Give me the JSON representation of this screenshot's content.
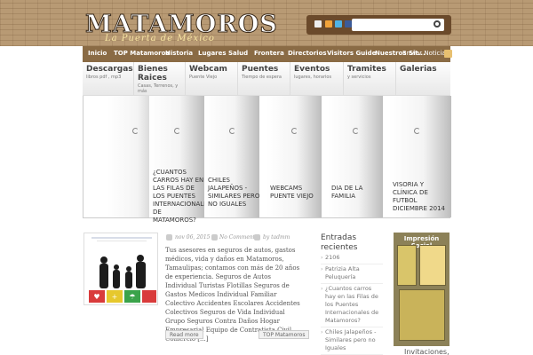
{
  "header": {
    "logo_main": "MATAMOROS",
    "logo_sub": "La Puerta de México",
    "social_icons": [
      "blank-icon",
      "rss-icon",
      "twitter-icon",
      "facebook-icon"
    ],
    "search_placeholder": ""
  },
  "nav": {
    "items": [
      "Inicio",
      "TOP Matamoros",
      "Historia",
      "Lugares",
      "Salud",
      "Frontera",
      "Directorios",
      "Visitors Guide",
      "Nuestros Sit..."
    ],
    "extra": "Enviar Noticias"
  },
  "subnav": [
    {
      "title": "Descargas",
      "desc": "libros pdf , mp3"
    },
    {
      "title": "Bienes Raices",
      "desc": "Casas, Terrenos, y más"
    },
    {
      "title": "Webcam",
      "desc": "Puente Viejo"
    },
    {
      "title": "Puentes",
      "desc": "Tiempo de espera"
    },
    {
      "title": "Eventos",
      "desc": "lugares, horarios"
    },
    {
      "title": "Tramites",
      "desc": "y servicios"
    },
    {
      "title": "Galerias",
      "desc": ""
    }
  ],
  "slides": [
    {
      "caption": ""
    },
    {
      "caption": "¿Cuantos carros hay en las filas de los puentes internacionales de Matamoros?"
    },
    {
      "caption": "Chiles Jalapeños - Similares pero no iguales"
    },
    {
      "caption": "Webcams Puente Viejo"
    },
    {
      "caption": "Dia de la Familia"
    },
    {
      "caption": "Visoria y Clínica de Futbol Diciembre 2014"
    }
  ],
  "post": {
    "date": "nov 06, 2015",
    "comments": "No Comments",
    "author": "by tadmm",
    "excerpt": "Tus asesores en seguros de autos, gastos médicos, vida y daños en Matamoros, Tamaulipas; contamos con más de 20 años de experiencia. Seguros de Autos Individual Turistas Flotillas Seguros de Gastos Medicos Individual Familiar Colectivo Accidentes Escolares Accidentes Colectivos Seguros de Vida Individual Grupo Seguros Contra Daños Hogar Empresarial Equipo de Contratista Civil Comercio [...]",
    "read_more": "Read more",
    "category": "TOP Matamoros"
  },
  "sidebar": {
    "title": "Entradas recientes",
    "items": [
      "2106",
      "Patrizia Alta Peluquería",
      "¿Cuantos carros hay en las Filas de los Puentes Internacionales de Matamoros?",
      "Chiles Jalapeños - Similares pero no Iguales"
    ]
  },
  "ad": {
    "title": "Impresión Social",
    "caption": "Invitaciones,"
  }
}
